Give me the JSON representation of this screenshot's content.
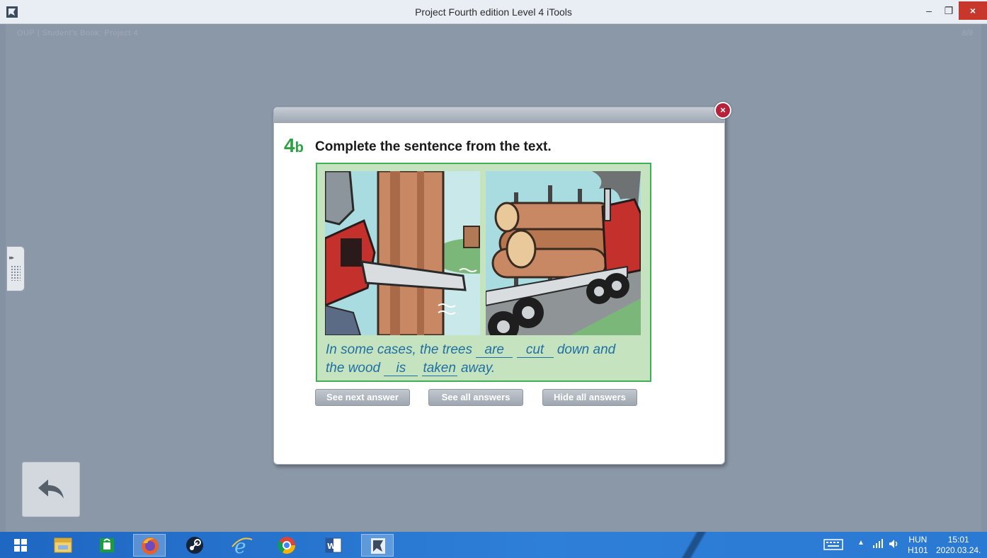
{
  "window": {
    "title": "Project Fourth edition Level 4 iTools",
    "minimize": "–",
    "maximize": "❐",
    "close": "×"
  },
  "app": {
    "breadcrumb": "OUP  |  Student's Book: Project 4",
    "page_count": "8/8"
  },
  "exercise": {
    "number": "4",
    "sub": "b",
    "title": "Complete the sentence from the text.",
    "sentence": {
      "part1": "In some cases, the trees ",
      "blank1": "are",
      "blank2": "cut",
      "part2": " down and",
      "part3": "the wood ",
      "blank3": "is",
      "blank4": "taken",
      "part4": " away."
    }
  },
  "buttons": {
    "see_next": "See next answer",
    "see_all": "See all answers",
    "hide_all": "Hide all answers"
  },
  "dialog": {
    "close": "×"
  },
  "sidetab": {
    "arrows": "▸▸"
  },
  "taskbar": {
    "items": [
      "start-icon",
      "file-explorer-icon",
      "store-icon",
      "firefox-icon",
      "steam-icon",
      "internet-explorer-icon",
      "chrome-icon",
      "word-icon",
      "itools-icon"
    ],
    "language_top": "HUN",
    "language_bottom": "H101",
    "time": "15:01",
    "date": "2020.03.24."
  },
  "colors": {
    "accent_green": "#2fa043",
    "sentence_blue": "#1f6fa3",
    "close_red": "#b7223b",
    "taskbar_blue": "#2a79d2"
  }
}
